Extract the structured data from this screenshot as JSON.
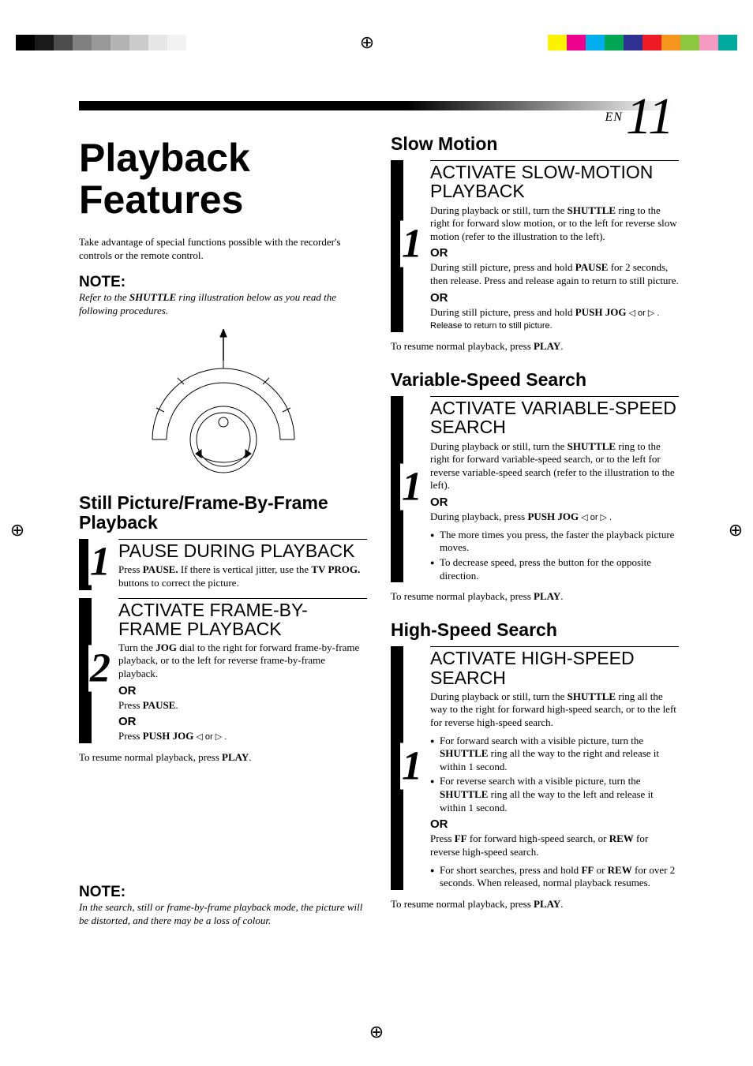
{
  "page": {
    "lang": "EN",
    "num": "11"
  },
  "marks": {
    "grayscale": [
      "#000000",
      "#1a1a1a",
      "#4d4d4d",
      "#808080",
      "#999999",
      "#b3b3b3",
      "#cccccc",
      "#e6e6e6",
      "#f2f2f2"
    ],
    "color": [
      "#fff200",
      "#ec008c",
      "#00aeef",
      "#00a651",
      "#2e3192",
      "#ed1c24",
      "#f7941d",
      "#8dc63f",
      "#f49ac1",
      "#00a99d"
    ]
  },
  "left": {
    "title": "Playback Features",
    "intro": "Take advantage of special functions possible with the recorder's controls or the remote control.",
    "note_h": "NOTE:",
    "note_body_a": "Refer to the ",
    "note_body_b": "SHUTTLE",
    "note_body_c": " ring illustration below as you read the following procedures.",
    "section1_h": "Still Picture/Frame-By-Frame Playback",
    "step1": {
      "num": "1",
      "title": "PAUSE DURING PLAYBACK",
      "body_a": "Press ",
      "body_b": "PAUSE.",
      "body_c": " If there is vertical jitter, use the ",
      "body_d": "TV PROG.",
      "body_e": " buttons to correct the picture."
    },
    "step2": {
      "num": "2",
      "title": "ACTIVATE FRAME-BY-FRAME PLAYBACK",
      "p1_a": "Turn the ",
      "p1_b": "JOG",
      "p1_c": " dial to the right for forward frame-by-frame playback, or to the left for reverse frame-by-frame playback.",
      "or1": "OR",
      "p2_a": "Press ",
      "p2_b": "PAUSE",
      "p2_c": ".",
      "or2": "OR",
      "p3_a": "Press ",
      "p3_b": "PUSH JOG",
      "p3_c": " ◁ or ▷ ."
    },
    "resume_a": "To resume normal playback, press ",
    "resume_b": "PLAY",
    "resume_c": ".",
    "note2_h": "NOTE:",
    "note2_body": "In the search, still or frame-by-frame playback mode, the picture will be distorted, and there may be a loss of colour."
  },
  "right": {
    "slow_h": "Slow Motion",
    "slow_step": {
      "num": "1",
      "title": "ACTIVATE SLOW-MOTION PLAYBACK",
      "p1_a": "During playback or still, turn the ",
      "p1_b": "SHUTTLE",
      "p1_c": " ring to the right for forward slow motion, or to the left for reverse slow motion (refer to the illustration to the left).",
      "or1": "OR",
      "p2_a": "During still picture, press and hold ",
      "p2_b": "PAUSE",
      "p2_c": "  for 2 seconds, then release. Press and release again to return to still picture.",
      "or2": "OR",
      "p3_a": "During still picture, press and hold ",
      "p3_b": "PUSH JOG",
      "p3_c": " ◁ or ▷ . Release to return to still picture."
    },
    "slow_resume_a": "To resume normal playback, press ",
    "slow_resume_b": "PLAY",
    "slow_resume_c": ".",
    "var_h": "Variable-Speed Search",
    "var_step": {
      "num": "1",
      "title": "ACTIVATE VARIABLE-SPEED SEARCH",
      "p1_a": "During playback or still, turn the ",
      "p1_b": "SHUTTLE",
      "p1_c": " ring to the right for forward variable-speed search, or to the left for reverse variable-speed search (refer to the illustration to the left).",
      "or1": "OR",
      "p2_a": "During playback, press ",
      "p2_b": "PUSH JOG",
      "p2_c": " ◁ or ▷ .",
      "bul1": "The more times you press, the faster the playback picture moves.",
      "bul2": "To decrease speed, press the button for the opposite direction."
    },
    "var_resume_a": "To resume normal playback, press ",
    "var_resume_b": "PLAY",
    "var_resume_c": ".",
    "hi_h": "High-Speed Search",
    "hi_step": {
      "num": "1",
      "title": "ACTIVATE HIGH-SPEED SEARCH",
      "p1_a": "During playback or still, turn the ",
      "p1_b": "SHUTTLE",
      "p1_c": " ring all the way to the right for forward high-speed search, or to the left for reverse high-speed search.",
      "bul1_a": "For forward search with a visible picture, turn the ",
      "bul1_b": "SHUTTLE",
      "bul1_c": " ring all the way to the right and release it within 1 second.",
      "bul2_a": "For reverse search with a visible picture, turn the ",
      "bul2_b": "SHUTTLE",
      "bul2_c": " ring all the way to the left and release it within 1 second.",
      "or1": "OR",
      "p2_a": "Press ",
      "p2_b": "FF",
      "p2_c": " for forward high-speed search, or ",
      "p2_d": "REW",
      "p2_e": " for reverse high-speed search.",
      "bul3_a": "For short searches, press and hold ",
      "bul3_b": "FF",
      "bul3_c": " or ",
      "bul3_d": "REW",
      "bul3_e": " for over 2 seconds. When released, normal playback resumes."
    },
    "hi_resume_a": "To resume normal playback, press ",
    "hi_resume_b": "PLAY",
    "hi_resume_c": "."
  }
}
